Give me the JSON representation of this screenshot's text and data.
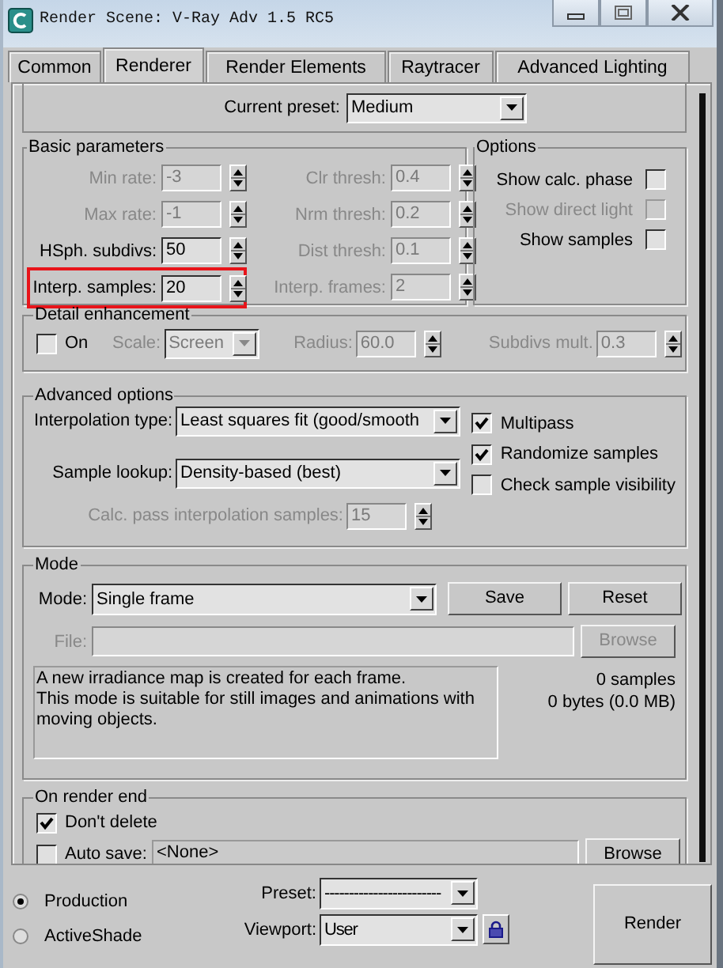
{
  "window": {
    "title": "Render Scene: V-Ray Adv 1.5 RC5"
  },
  "tabs": [
    {
      "label": "Common",
      "selected": false
    },
    {
      "label": "Renderer",
      "selected": true
    },
    {
      "label": "Render Elements",
      "selected": false
    },
    {
      "label": "Raytracer",
      "selected": false
    },
    {
      "label": "Advanced Lighting",
      "selected": false
    }
  ],
  "current_preset": {
    "label": "Current preset:",
    "value": "Medium"
  },
  "basic_parameters": {
    "title": "Basic parameters",
    "left": [
      {
        "label": "Min rate:",
        "value": "-3",
        "disabled": true
      },
      {
        "label": "Max rate:",
        "value": "-1",
        "disabled": true
      },
      {
        "label": "HSph. subdivs:",
        "value": "50",
        "disabled": false
      },
      {
        "label": "Interp. samples:",
        "value": "20",
        "disabled": false,
        "highlighted": true
      }
    ],
    "right": [
      {
        "label": "Clr thresh:",
        "value": "0.4",
        "disabled": true
      },
      {
        "label": "Nrm thresh:",
        "value": "0.2",
        "disabled": true
      },
      {
        "label": "Dist thresh:",
        "value": "0.1",
        "disabled": true
      },
      {
        "label": "Interp. frames:",
        "value": "2",
        "disabled": true
      }
    ]
  },
  "options": {
    "title": "Options",
    "items": [
      {
        "label": "Show calc. phase",
        "checked": false,
        "disabled": false
      },
      {
        "label": "Show direct light",
        "checked": false,
        "disabled": true
      },
      {
        "label": "Show samples",
        "checked": false,
        "disabled": false
      }
    ]
  },
  "detail_enhancement": {
    "title": "Detail enhancement",
    "on": {
      "label": "On",
      "checked": false
    },
    "scale": {
      "label": "Scale:",
      "value": "Screen",
      "disabled": true
    },
    "radius": {
      "label": "Radius:",
      "value": "60.0",
      "disabled": true
    },
    "subdivs_mult": {
      "label": "Subdivs mult.",
      "value": "0.3",
      "disabled": true
    }
  },
  "advanced_options": {
    "title": "Advanced options",
    "interpolation_type": {
      "label": "Interpolation type:",
      "value": "Least squares fit (good/smooth"
    },
    "sample_lookup": {
      "label": "Sample lookup:",
      "value": "Density-based (best)"
    },
    "calc_pass": {
      "label": "Calc. pass interpolation samples:",
      "value": "15",
      "disabled": true
    },
    "checks": [
      {
        "label": "Multipass",
        "checked": true
      },
      {
        "label": "Randomize samples",
        "checked": true
      },
      {
        "label": "Check sample visibility",
        "checked": false
      }
    ]
  },
  "mode": {
    "title": "Mode",
    "mode": {
      "label": "Mode:",
      "value": "Single frame"
    },
    "buttons": [
      "Save",
      "Reset"
    ],
    "file": {
      "label": "File:",
      "disabled": true
    },
    "browse": {
      "label": "Browse",
      "disabled": true
    },
    "description": "A new irradiance map is created for each frame.\nThis mode is suitable for still images and animations with\nmoving objects.",
    "stats": [
      "0 samples",
      "0 bytes (0.0 MB)"
    ]
  },
  "on_render_end": {
    "title": "On render end",
    "dont_delete": {
      "label": "Don't delete",
      "checked": true
    },
    "auto_save": {
      "label": "Auto save:",
      "checked": false,
      "value": "<None>"
    },
    "browse": "Browse"
  },
  "render_target": [
    {
      "label": "Production",
      "selected": true
    },
    {
      "label": "ActiveShade",
      "selected": false
    }
  ],
  "preset": {
    "label": "Preset:",
    "value": "------------------------"
  },
  "viewport": {
    "label": "Viewport:",
    "value": "User"
  },
  "render_button": "Render"
}
